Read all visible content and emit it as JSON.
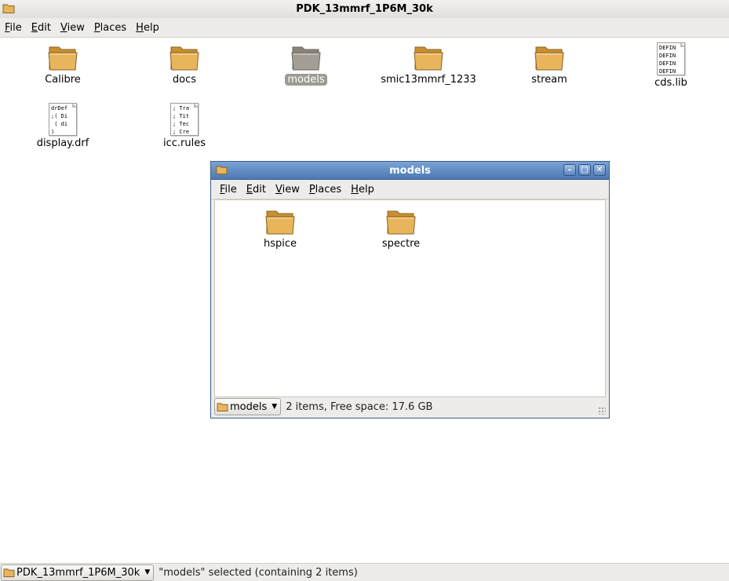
{
  "main_window": {
    "title": "PDK_13mmrf_1P6M_30k",
    "menu": [
      {
        "key": "F",
        "rest": "ile"
      },
      {
        "key": "E",
        "rest": "dit"
      },
      {
        "key": "V",
        "rest": "iew"
      },
      {
        "key": "P",
        "rest": "laces"
      },
      {
        "key": "H",
        "rest": "elp"
      }
    ],
    "items": [
      {
        "label": "Calibre",
        "kind": "folder"
      },
      {
        "label": "docs",
        "kind": "folder"
      },
      {
        "label": "models",
        "kind": "folder",
        "selected": true
      },
      {
        "label": "smic13mmrf_1233",
        "kind": "folder"
      },
      {
        "label": "stream",
        "kind": "folder"
      },
      {
        "label": "cds.lib",
        "kind": "file",
        "preview": "DEFIN\nDEFIN\nDEFIN\nDEFIN"
      },
      {
        "label": "display.drf",
        "kind": "file",
        "preview": "drDef\n;( Di\n ( di\n)"
      },
      {
        "label": "icc.rules",
        "kind": "file",
        "preview": "; Tra\n; Tit\n; Tec\n; Cre"
      }
    ],
    "path_button": "PDK_13mmrf_1P6M_30k",
    "status": "\"models\" selected (containing 2 items)"
  },
  "child_window": {
    "title": "models",
    "menu": [
      {
        "key": "F",
        "rest": "ile"
      },
      {
        "key": "E",
        "rest": "dit"
      },
      {
        "key": "V",
        "rest": "iew"
      },
      {
        "key": "P",
        "rest": "laces"
      },
      {
        "key": "H",
        "rest": "elp"
      }
    ],
    "items": [
      {
        "label": "hspice",
        "kind": "folder"
      },
      {
        "label": "spectre",
        "kind": "folder"
      }
    ],
    "path_button": "models",
    "status": "2 items, Free space: 17.6 GB"
  },
  "colors": {
    "folder_body": "#e8b45c",
    "folder_selected": "#a39e94",
    "child_title_bar": "#5f89c0"
  }
}
